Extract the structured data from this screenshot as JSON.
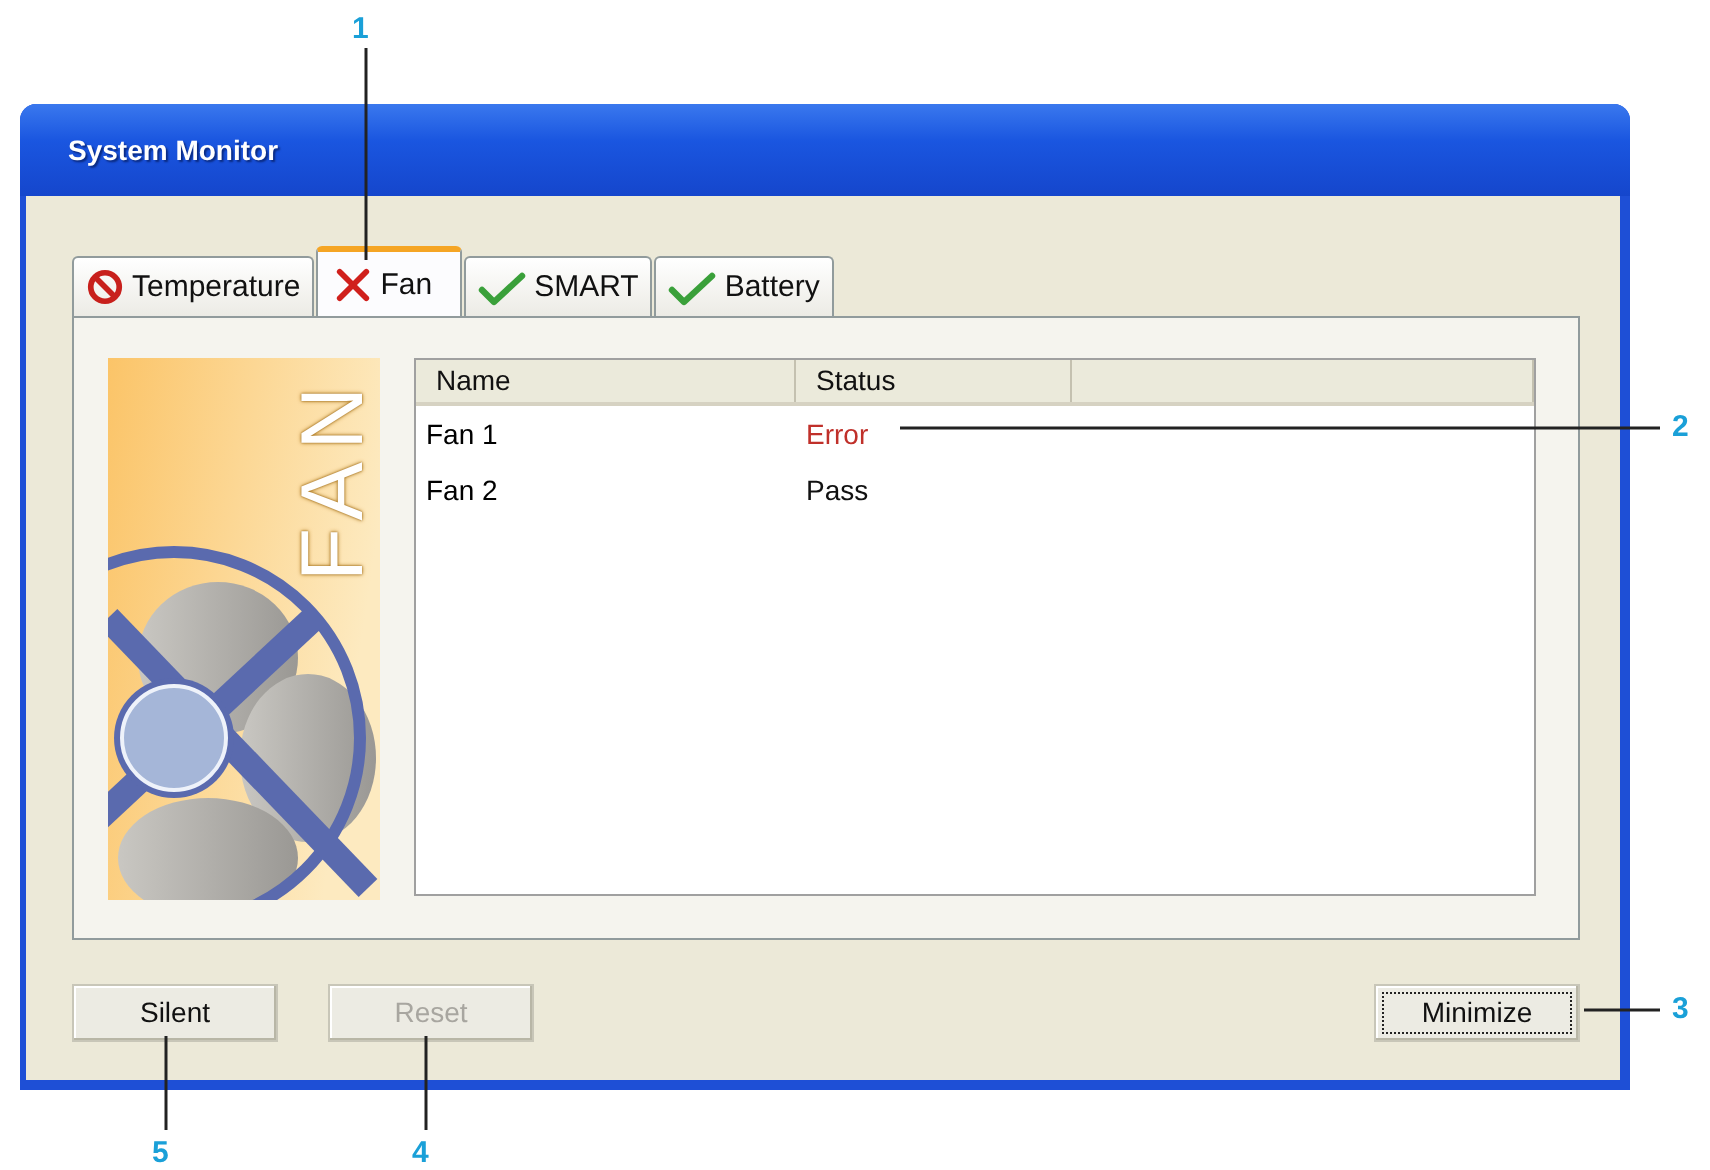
{
  "window": {
    "title": "System Monitor"
  },
  "tabs": [
    {
      "label": "Temperature",
      "kind": "blocked",
      "selected": false
    },
    {
      "label": "Fan",
      "kind": "error",
      "selected": true
    },
    {
      "label": "SMART",
      "kind": "ok",
      "selected": false
    },
    {
      "label": "Battery",
      "kind": "ok",
      "selected": false
    }
  ],
  "panel": {
    "banner_text": "FAN",
    "table": {
      "columns": [
        "Name",
        "Status"
      ],
      "rows": [
        {
          "name": "Fan 1",
          "status": "Error",
          "kind": "error"
        },
        {
          "name": "Fan 2",
          "status": "Pass",
          "kind": "pass"
        }
      ]
    }
  },
  "buttons": [
    {
      "label": "Silent",
      "disabled": false,
      "focused": false
    },
    {
      "label": "Reset",
      "disabled": true,
      "focused": false
    },
    {
      "label": "Minimize",
      "disabled": false,
      "focused": true
    }
  ],
  "callouts": [
    {
      "label": "1"
    },
    {
      "label": "2"
    },
    {
      "label": "3"
    },
    {
      "label": "4"
    },
    {
      "label": "5"
    }
  ]
}
